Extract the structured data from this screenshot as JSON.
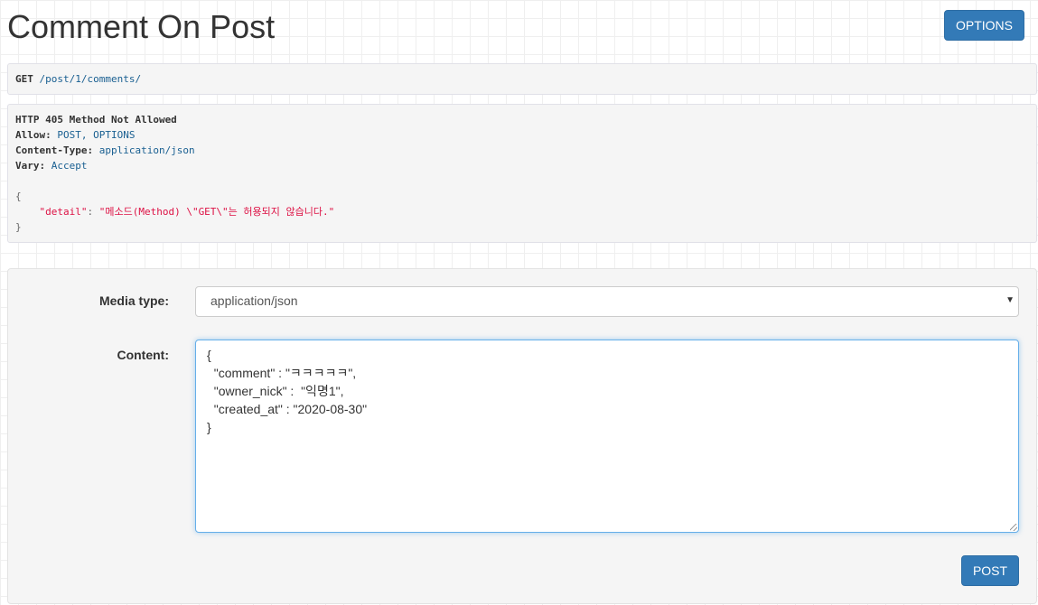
{
  "title": "Comment On Post",
  "options_button": "OPTIONS",
  "request": {
    "method": "GET",
    "path": " /post/1/comments/"
  },
  "response": {
    "status_line": "HTTP 405 Method Not Allowed",
    "headers": [
      {
        "name": "Allow:",
        "value": " POST, OPTIONS"
      },
      {
        "name": "Content-Type:",
        "value": " application/json"
      },
      {
        "name": "Vary:",
        "value": " Accept"
      }
    ],
    "body": {
      "open": "{",
      "key": "\"detail\"",
      "colon": ": ",
      "value": "\"메소드(Method) \\\"GET\\\"는 허용되지 않습니다.\"",
      "close": "}"
    }
  },
  "form": {
    "media_type_label": "Media type:",
    "media_type_value": "application/json",
    "content_label": "Content:",
    "content_value": "{\n  \"comment\" : \"ㅋㅋㅋㅋㅋ\",\n  \"owner_nick\" :  \"익명1\",\n  \"created_at\" : \"2020-08-30\"\n}",
    "post_button": "POST"
  },
  "colors": {
    "primary": "#337ab7",
    "string": "#dd1144",
    "literal": "#195f91"
  }
}
